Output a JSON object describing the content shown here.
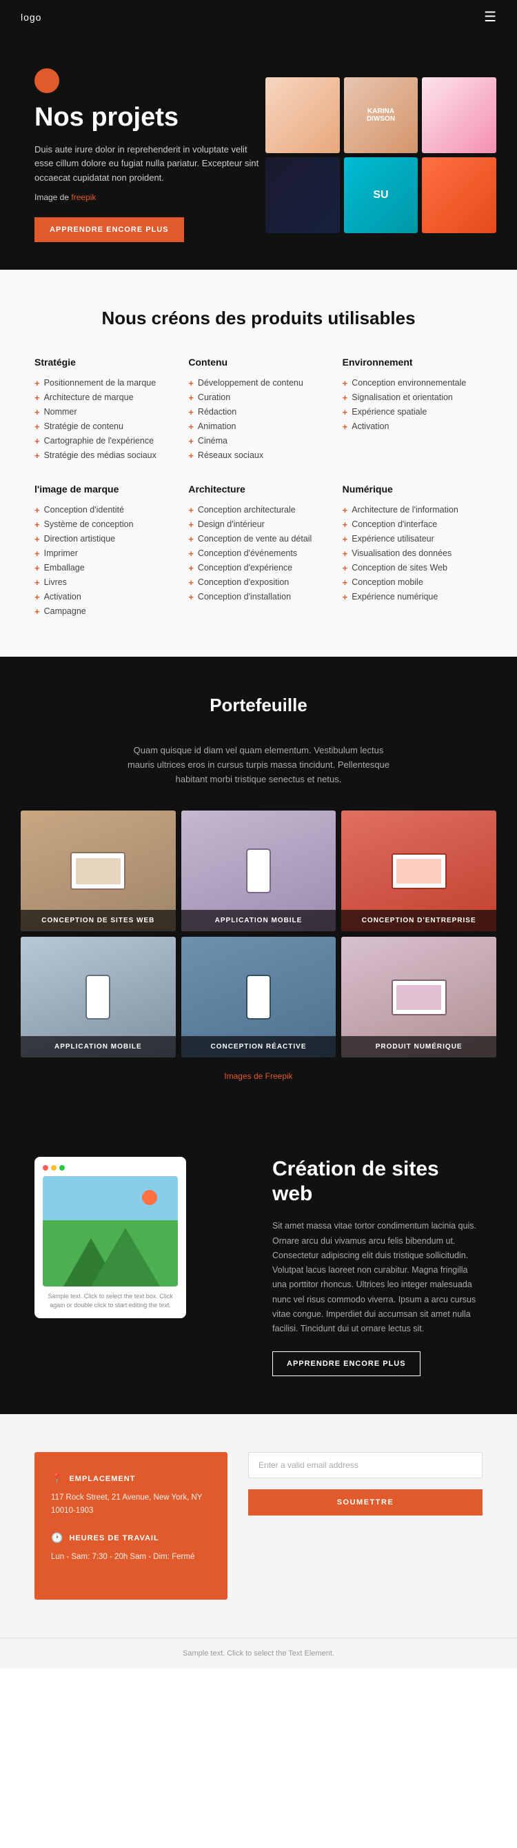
{
  "header": {
    "logo": "logo"
  },
  "hero": {
    "title": "Nos projets",
    "description": "Duis aute irure dolor in reprehenderit in voluptate velit esse cillum dolore eu fugiat nulla pariatur. Excepteur sint occaecat cupidatat non proident.",
    "image_credit_prefix": "Image de ",
    "image_credit_link": "freepik",
    "cta_label": "APPRENDRE ENCORE PLUS"
  },
  "services": {
    "section_title": "Nous créons des produits utilisables",
    "columns": [
      {
        "heading": "Stratégie",
        "items": [
          "Positionnement de la marque",
          "Architecture de marque",
          "Nommer",
          "Stratégie de contenu",
          "Cartographie de l'expérience",
          "Stratégie des médias sociaux"
        ]
      },
      {
        "heading": "Contenu",
        "items": [
          "Développement de contenu",
          "Curation",
          "Rédaction",
          "Animation",
          "Cinéma",
          "Réseaux sociaux"
        ]
      },
      {
        "heading": "Environnement",
        "items": [
          "Conception environnementale",
          "Signalisation et orientation",
          "Expérience spatiale",
          "Activation"
        ]
      },
      {
        "heading": "l'image de marque",
        "items": [
          "Conception d'identité",
          "Système de conception",
          "Direction artistique",
          "Imprimer",
          "Emballage",
          "Livres",
          "Activation",
          "Campagne"
        ]
      },
      {
        "heading": "Architecture",
        "items": [
          "Conception architecturale",
          "Design d'intérieur",
          "Conception de vente au détail",
          "Conception d'événements",
          "Conception d'expérience",
          "Conception d'exposition",
          "Conception d'installation"
        ]
      },
      {
        "heading": "Numérique",
        "items": [
          "Architecture de l'information",
          "Conception d'interface",
          "Expérience utilisateur",
          "Visualisation des données",
          "Conception de sites Web",
          "Conception mobile",
          "Expérience numérique"
        ]
      }
    ]
  },
  "portfolio": {
    "section_title": "Portefeuille",
    "description": "Quam quisque id diam vel quam elementum. Vestibulum lectus mauris ultrices eros in cursus turpis massa tincidunt. Pellentesque habitant morbi tristique senectus et netus.",
    "items": [
      {
        "label": "CONCEPTION DE SITES WEB"
      },
      {
        "label": "APPLICATION MOBILE"
      },
      {
        "label": "CONCEPTION D'ENTREPRISE"
      },
      {
        "label": "APPLICATION MOBILE"
      },
      {
        "label": "CONCEPTION RÉACTIVE"
      },
      {
        "label": "PRODUIT NUMÉRIQUE"
      }
    ],
    "credit_prefix": "Images de ",
    "credit_link": "Freepik"
  },
  "web_creation": {
    "title": "Création de sites web",
    "description": "Sit amet massa vitae tortor condimentum lacinia quis. Ornare arcu dui vivamus arcu felis bibendum ut. Consectetur adipiscing elit duis tristique sollicitudin. Volutpat lacus laoreet non curabitur. Magna fringilla una porttitor rhoncus. Ultrices leo integer malesuada nunc vel risus commodo viverra. Ipsum a arcu cursus vitae congue. Imperdiet dui accumsan sit amet nulla facilisi. Tincidunt dui ut ornare lectus sit.",
    "cta_label": "APPRENDRE ENCORE PLUS",
    "mockup_caption": "Sample text. Click to select the text box. Click again or double click to start editing the text."
  },
  "contact": {
    "location_heading": "EMPLACEMENT",
    "location_icon": "📍",
    "location_text": "117 Rock Street, 21 Avenue, New York, NY 10010-1903",
    "hours_heading": "HEURES DE TRAVAIL",
    "hours_icon": "🕐",
    "hours_text": "Lun - Sam:   7:30 - 20h  Sam - Dim: Fermé",
    "form": {
      "email_placeholder": "Enter a valid email address",
      "submit_label": "SOUMETTRE"
    }
  },
  "footer": {
    "text": "Sample text. Click to select the Text Element."
  }
}
